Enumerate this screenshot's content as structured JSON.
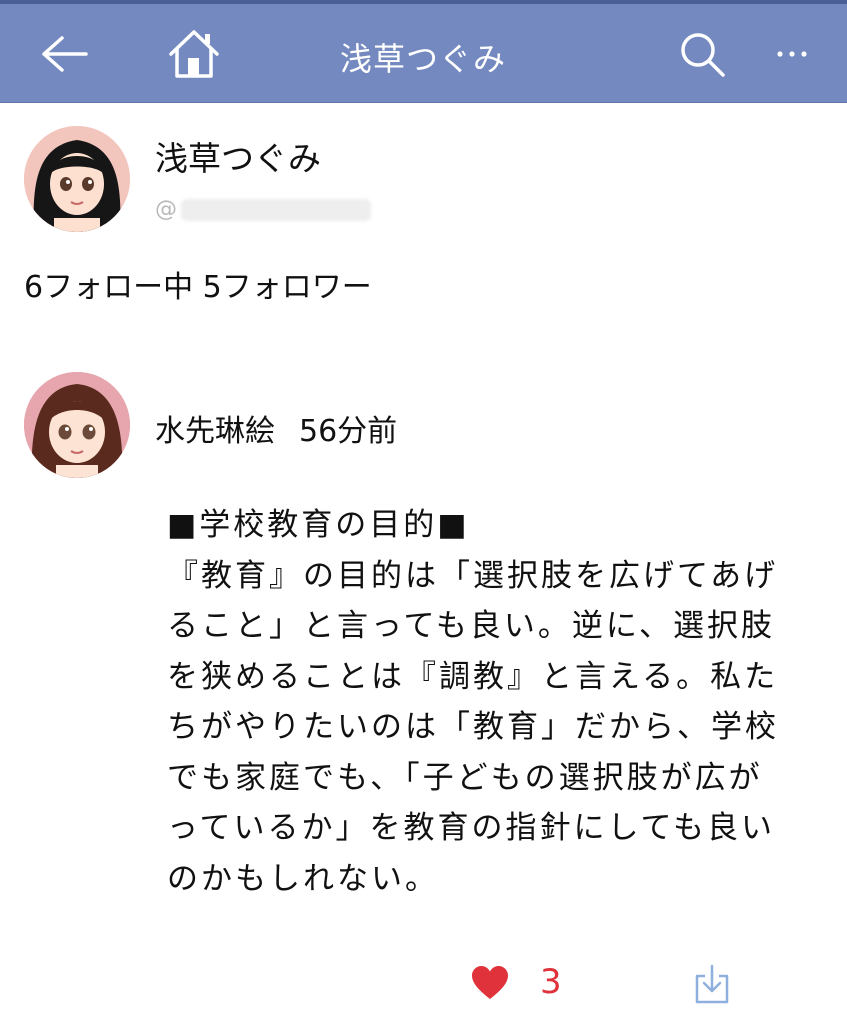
{
  "colors": {
    "navbar": "#7389bf",
    "like": "#e0323b",
    "download": "#8fb0de"
  },
  "icons": {
    "back": "back-arrow-icon",
    "home": "home-icon",
    "search": "search-icon",
    "more": "more-icon",
    "like": "heart-icon",
    "share": "download-icon"
  },
  "header": {
    "title": "浅草つぐみ"
  },
  "profile": {
    "name": "浅草つぐみ",
    "handle_prefix": "@",
    "stats": "6フォロー中 5フォロワー"
  },
  "post": {
    "author": "水先琳絵",
    "time": "56分前",
    "lines": [
      "■学校教育の目的■",
      "『教育』の目的は「選択肢を広げてあげ",
      "ること」と言っても良い。逆に、選択肢",
      "を狭めることは『調教』と言える。私た",
      "ちがやりたいのは「教育」だから、学校",
      "でも家庭でも、「子どもの選択肢が広が",
      "っているか」を教育の指針にしても良い",
      "のかもしれない。"
    ],
    "like_count": "3"
  }
}
